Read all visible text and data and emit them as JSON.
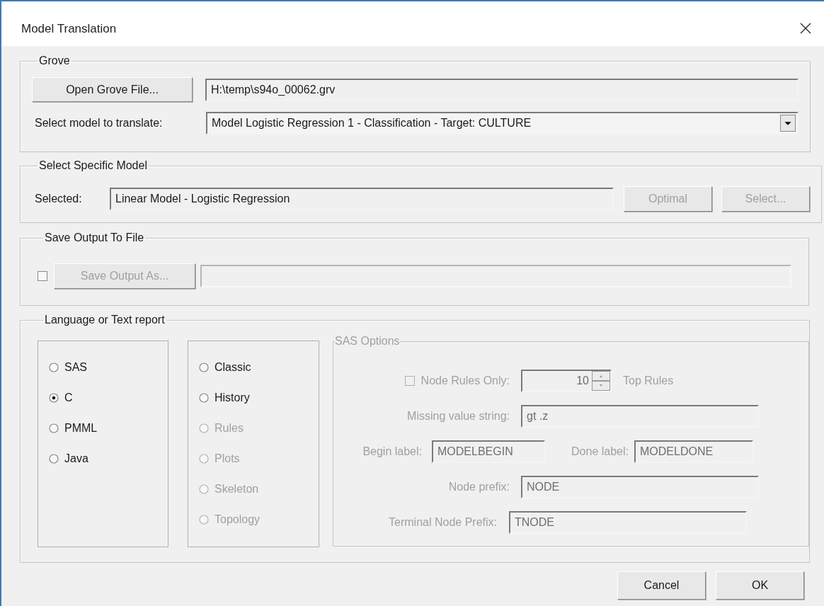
{
  "window": {
    "title": "Model Translation"
  },
  "grove": {
    "title": "Grove",
    "open_button": "Open Grove File...",
    "file_path": "H:\\temp\\s94o_00062.grv",
    "model_label": "Select model to translate:",
    "model_value": "Model Logistic Regression 1 - Classification - Target: CULTURE"
  },
  "specific_model": {
    "title": "Select Specific Model",
    "selected_label": "Selected:",
    "selected_value": "Linear Model - Logistic Regression",
    "buttons": [
      {
        "label": "Optimal",
        "disabled": true
      },
      {
        "label": "Select...",
        "disabled": true
      }
    ]
  },
  "save_output": {
    "title": "Save Output To File",
    "checked": false,
    "button": {
      "label": "Save Output As...",
      "disabled": true
    }
  },
  "language": {
    "title": "Language or Text report",
    "languages": [
      {
        "label": "SAS",
        "selected": false
      },
      {
        "label": "C",
        "selected": true
      },
      {
        "label": "PMML",
        "selected": false
      },
      {
        "label": "Java",
        "selected": false
      }
    ],
    "reports": [
      {
        "label": "Classic",
        "selected": false,
        "disabled": false
      },
      {
        "label": "History",
        "selected": false,
        "disabled": false
      },
      {
        "label": "Rules",
        "selected": false,
        "disabled": true
      },
      {
        "label": "Plots",
        "selected": false,
        "disabled": true
      },
      {
        "label": "Skeleton",
        "selected": false,
        "disabled": true
      },
      {
        "label": "Topology",
        "selected": false,
        "disabled": true
      }
    ],
    "sas_options": {
      "title": "SAS Options",
      "disabled": true,
      "node_rules": {
        "label": "Node Rules Only:",
        "checked": false,
        "value": "10",
        "suffix": "Top Rules"
      },
      "missing": {
        "label": "Missing value string:",
        "value": "gt .z"
      },
      "begin": {
        "label": "Begin label:",
        "value": "MODELBEGIN"
      },
      "done": {
        "label": "Done label:",
        "value": "MODELDONE"
      },
      "node_prefix": {
        "label": "Node prefix:",
        "value": "NODE"
      },
      "terminal_prefix": {
        "label": "Terminal Node Prefix:",
        "value": "TNODE"
      }
    }
  },
  "buttons": [
    {
      "label": "Cancel"
    },
    {
      "label": "OK"
    }
  ]
}
